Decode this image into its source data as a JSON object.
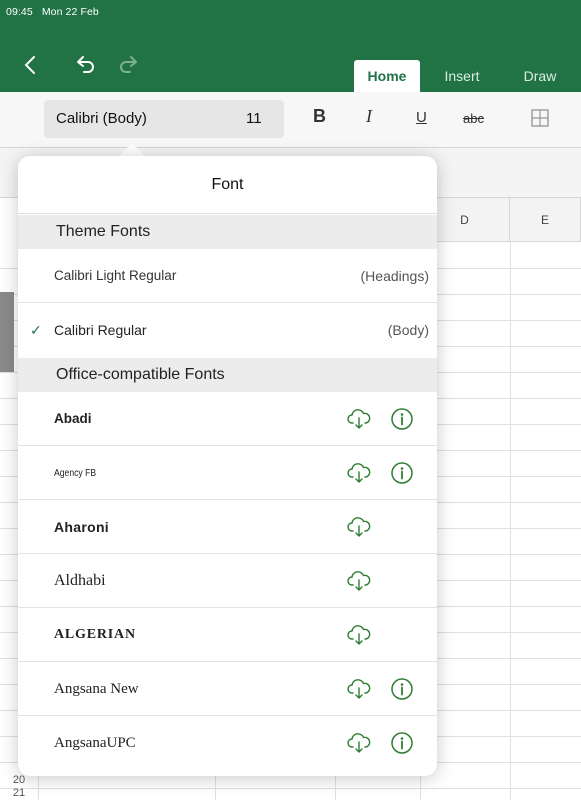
{
  "status": {
    "time": "09:45",
    "date": "Mon 22 Feb"
  },
  "tabs": [
    {
      "label": "Home",
      "active": true
    },
    {
      "label": "Insert",
      "active": false
    },
    {
      "label": "Draw",
      "active": false
    }
  ],
  "ribbon": {
    "font_name": "Calibri (Body)",
    "font_size": "11",
    "bold": "B",
    "italic": "I",
    "underline": "U",
    "strikethrough": "abc"
  },
  "sheet": {
    "columns": [
      "D",
      "E"
    ],
    "row_numbers": [
      "20",
      "21"
    ]
  },
  "font_popover": {
    "title": "Font",
    "theme_section": "Theme Fonts",
    "theme_fonts": [
      {
        "name": "Calibri Light Regular",
        "tag": "(Headings)",
        "selected": false
      },
      {
        "name": "Calibri Regular",
        "tag": "(Body)",
        "selected": true
      }
    ],
    "office_section": "Office-compatible Fonts",
    "office_fonts": [
      {
        "name": "Abadi",
        "info": true
      },
      {
        "name": "Agency FB",
        "info": true
      },
      {
        "name": "Aharoni",
        "info": false
      },
      {
        "name": "Aldhabi",
        "info": false
      },
      {
        "name": "ALGERIAN",
        "info": false
      },
      {
        "name": "Angsana New",
        "info": true
      },
      {
        "name": "AngsanaUPC",
        "info": true
      }
    ],
    "check_glyph": "✓"
  },
  "colors": {
    "accent": "#217346",
    "icon_green": "#2e7d32"
  }
}
